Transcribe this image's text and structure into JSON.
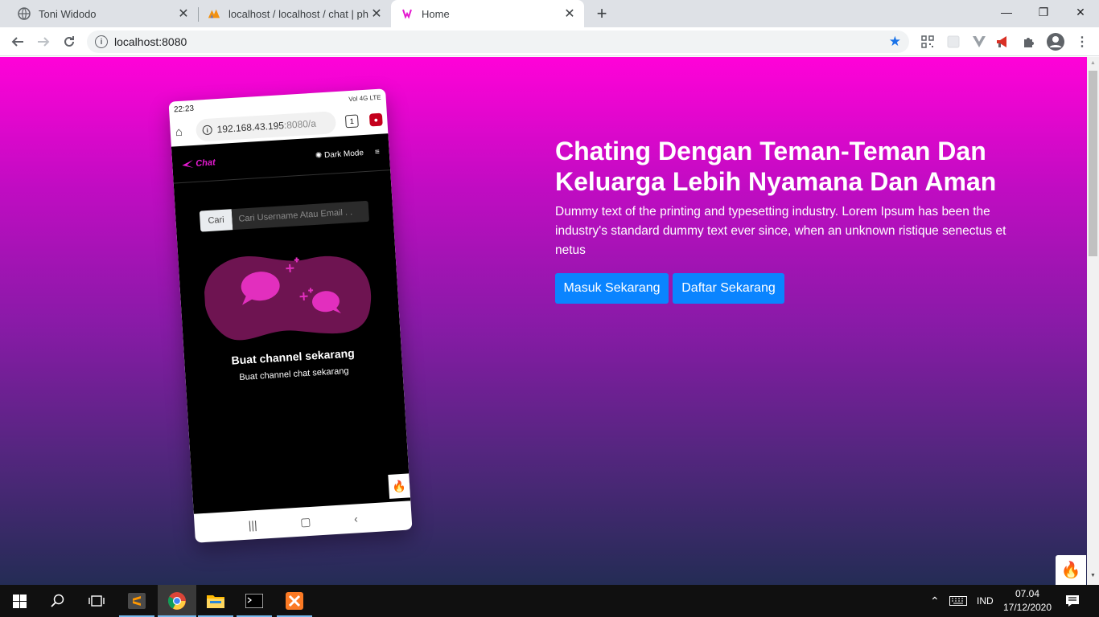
{
  "browser": {
    "tabs": [
      {
        "title": "Toni Widodo",
        "icon": "globe-icon",
        "active": false
      },
      {
        "title": "localhost / localhost / chat | phpMyAdmin",
        "icon": "phpmyadmin-icon",
        "active": false
      },
      {
        "title": "Home",
        "icon": "chat-logo-icon",
        "active": true
      }
    ],
    "url": "localhost:8080",
    "window_controls": {
      "minimize": "—",
      "maximize": "❐",
      "close": "✕"
    }
  },
  "hero": {
    "title": "Chating Dengan Teman-Teman Dan Keluarga Lebih Nyamana Dan Aman",
    "text": "Dummy text of the printing and typesetting industry. Lorem Ipsum has been the industry's standard dummy text ever since, when an unknown ristique senectus et netus",
    "buttons": {
      "login": "Masuk Sekarang",
      "register": "Daftar Sekarang"
    }
  },
  "phone": {
    "status_time": "22:23",
    "status_right": "Vol 4G LTE",
    "url_host": "192.168.43.195",
    "url_rest": ":8080/a",
    "tabs_count": "1",
    "logo": "Chat",
    "dark_mode_label": "Dark Mode",
    "search_label": "Cari",
    "search_placeholder": "Cari Username Atau Email . .",
    "heading": "Buat channel sekarang",
    "subheading": "Buat channel chat sekarang"
  },
  "taskbar": {
    "language": "IND",
    "time": "07.04",
    "date": "17/12/2020",
    "apps": [
      "sublime-text",
      "chrome",
      "file-explorer",
      "terminal",
      "xampp"
    ]
  },
  "colors": {
    "accent_button": "#0a84ff",
    "gradient_top": "#ff02d8",
    "gradient_bottom": "#242c55"
  }
}
